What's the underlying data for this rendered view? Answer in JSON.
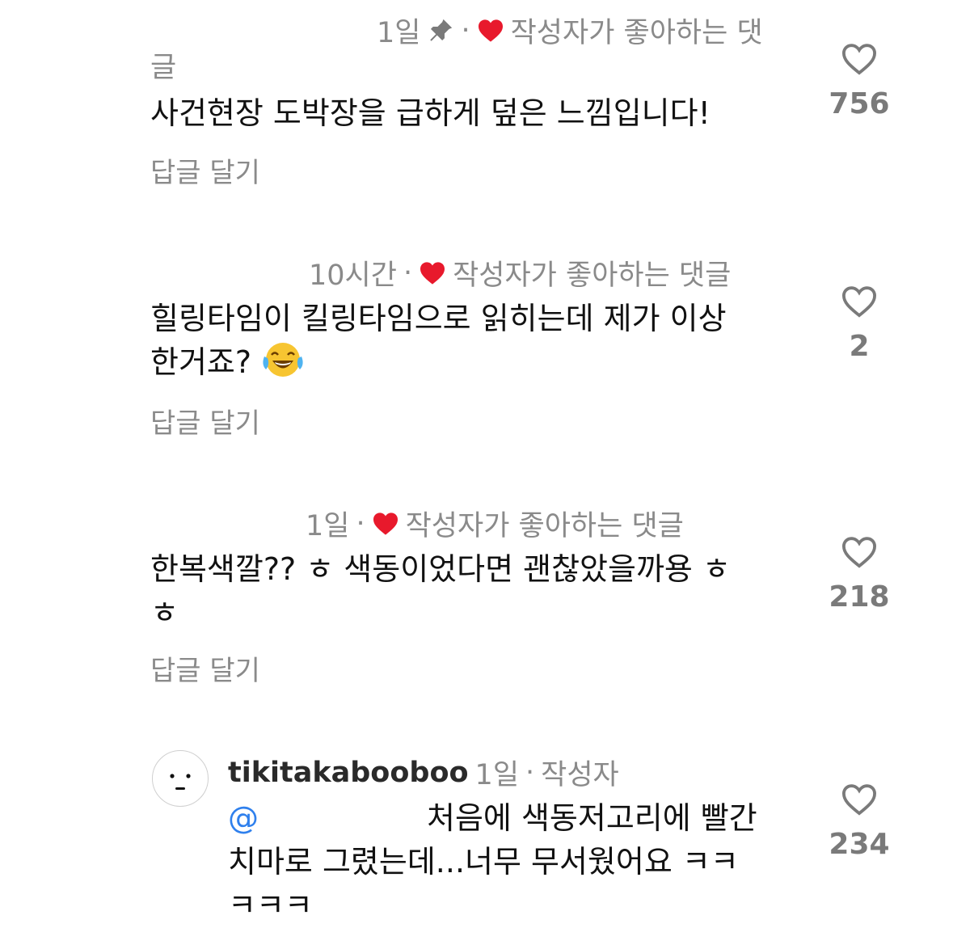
{
  "comments": [
    {
      "meta": {
        "time": "1일",
        "separator": "·",
        "liked_label": "작성자가 좋아하는 댓",
        "liked_label_wrap": "글"
      },
      "text": "사건현장 도박장을 급하게 덮은 느낌입니다!",
      "reply_label": "답글 달기",
      "like_count": "756",
      "pinned": true
    },
    {
      "meta": {
        "time": "10시간",
        "separator": "·",
        "liked_label": "작성자가 좋아하는 댓글"
      },
      "text_line1": "힐링타임이 킬링타임으로 읽히는데 제가 이상",
      "text_line2": "한거죠?",
      "emoji": "face-with-tears-of-joy",
      "reply_label": "답글 달기",
      "like_count": "2"
    },
    {
      "meta": {
        "time": "1일",
        "separator": "·",
        "liked_label": "작성자가 좋아하는 댓글"
      },
      "text_line1": "한복색깔?? ㅎ 색동이었다면 괜찮았을까용 ㅎ",
      "text_line2": "ㅎ",
      "reply_label": "답글 달기",
      "like_count": "218"
    },
    {
      "username": "tikitakabooboo",
      "meta": {
        "time": "1일",
        "separator": "·",
        "role": "작성자"
      },
      "mention": "@",
      "text_line1": "처음에 색동저고리에 빨간",
      "text_line2": "치마로 그렸는데...너무 무서웠어요 ㅋㅋ",
      "text_line3": "ㅋㅋㅋ",
      "like_count": "234"
    }
  ],
  "colors": {
    "heart_red": "#e8192c",
    "meta_gray": "#8a8a8a",
    "mention_blue": "#2f80ed"
  }
}
